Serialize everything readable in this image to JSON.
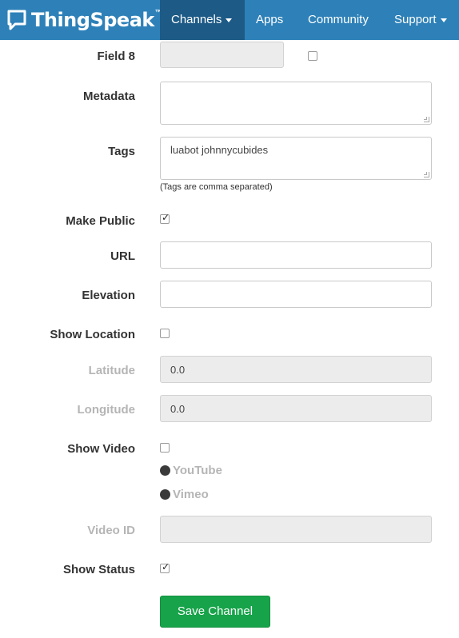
{
  "navbar": {
    "brand": "ThingSpeak",
    "brand_tm": "™",
    "items": [
      {
        "label": "Channels",
        "active": true,
        "dropdown": true
      },
      {
        "label": "Apps",
        "active": false,
        "dropdown": false
      },
      {
        "label": "Community",
        "active": false,
        "dropdown": false
      },
      {
        "label": "Support",
        "active": false,
        "dropdown": true
      }
    ],
    "color": "#2e81b8",
    "active_color": "#1d5a86"
  },
  "form": {
    "field8": {
      "label": "Field 8",
      "value": "",
      "checked": false
    },
    "metadata": {
      "label": "Metadata",
      "value": ""
    },
    "tags": {
      "label": "Tags",
      "value": "luabot johnnycubides",
      "help": "(Tags are comma separated)"
    },
    "make_public": {
      "label": "Make Public",
      "checked": true
    },
    "url": {
      "label": "URL",
      "value": ""
    },
    "elevation": {
      "label": "Elevation",
      "value": ""
    },
    "show_location": {
      "label": "Show Location",
      "checked": false
    },
    "latitude": {
      "label": "Latitude",
      "value": "0.0"
    },
    "longitude": {
      "label": "Longitude",
      "value": "0.0"
    },
    "show_video": {
      "label": "Show Video",
      "checked": false
    },
    "video_options": [
      "YouTube",
      "Vimeo"
    ],
    "video_id": {
      "label": "Video ID",
      "value": ""
    },
    "show_status": {
      "label": "Show Status",
      "checked": true
    },
    "save_label": "Save Channel",
    "save_color": "#17a34a"
  },
  "icons": {
    "brand": "chat-bubble-icon",
    "check": "✓"
  }
}
